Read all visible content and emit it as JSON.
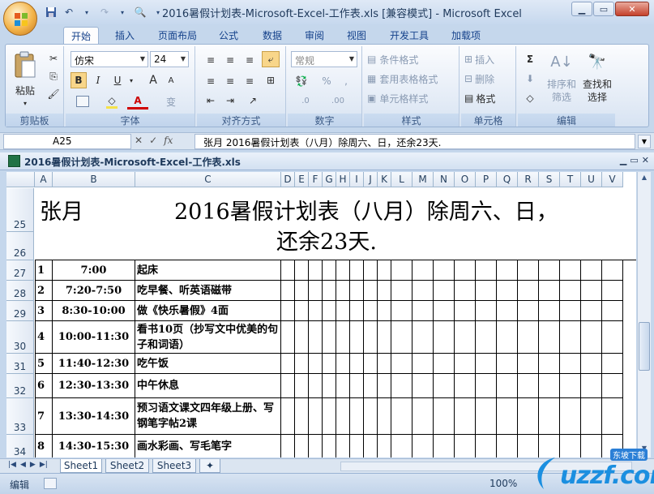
{
  "window": {
    "title": "2016暑假计划表-Microsoft-Excel-工作表.xls  [兼容模式] - Microsoft Excel"
  },
  "quick_access": {
    "save_icon": "save-icon",
    "undo_icon": "undo-icon",
    "redo_icon": "redo-icon",
    "preview_icon": "print-preview-icon"
  },
  "tabs": [
    "开始",
    "插入",
    "页面布局",
    "公式",
    "数据",
    "审阅",
    "视图",
    "开发工具",
    "加载项"
  ],
  "ribbon": {
    "clipboard": {
      "label": "剪贴板",
      "paste": "粘贴"
    },
    "font": {
      "label": "字体",
      "name": "仿宋",
      "size": "24",
      "bold": "B",
      "italic": "I",
      "underline": "U",
      "grow": "A",
      "shrink": "A",
      "font_color": "A",
      "phonetic": "变"
    },
    "alignment": {
      "label": "对齐方式"
    },
    "number": {
      "label": "数字",
      "format": "常规",
      "percent": "%",
      "comma": ",",
      "inc_decimal": ".0",
      "dec_decimal": ".00"
    },
    "styles": {
      "label": "样式",
      "conditional": "条件格式",
      "table": "套用表格格式",
      "cell_styles": "单元格样式"
    },
    "cells": {
      "label": "单元格",
      "insert": "插入",
      "delete": "删除",
      "format": "格式"
    },
    "editing": {
      "label": "编辑",
      "sum": "Σ",
      "sort": "排序和\n筛选",
      "find": "查找和\n选择"
    }
  },
  "formula_bar": {
    "name_box": "A25",
    "cancel": "✕",
    "enter": "✓",
    "fx": "fx",
    "content": "张月          2016暑假计划表（八月）除周六、日，还余23天."
  },
  "document": {
    "title": "2016暑假计划表-Microsoft-Excel-工作表.xls"
  },
  "columns": [
    "A",
    "B",
    "C",
    "D",
    "E",
    "F",
    "G",
    "H",
    "I",
    "J",
    "K",
    "L",
    "M",
    "N",
    "O",
    "P",
    "Q",
    "R",
    "S",
    "T",
    "U",
    "V"
  ],
  "sheet": {
    "title_owner": "张月",
    "title_line1": "2016暑假计划表（八月）除周六、日，",
    "title_line2": "还余23天.",
    "rows": [
      {
        "row": "27",
        "num": "1",
        "time": "7:00",
        "task": "起床"
      },
      {
        "row": "28",
        "num": "2",
        "time": "7:20-7:50",
        "task": "吃早餐、听英语磁带"
      },
      {
        "row": "29",
        "num": "3",
        "time": "8:30-10:00",
        "task": "做《快乐暑假》4面"
      },
      {
        "row": "30",
        "num": "4",
        "time": "10:00-11:30",
        "task": "看书10页（抄写文中优美的句子和词语）"
      },
      {
        "row": "31",
        "num": "5",
        "time": "11:40-12:30",
        "task": "吃午饭"
      },
      {
        "row": "32",
        "num": "6",
        "time": "12:30-13:30",
        "task": "中午休息"
      },
      {
        "row": "33",
        "num": "7",
        "time": "13:30-14:30",
        "task": "预习语文课文四年级上册、写钢笔字帖2课"
      },
      {
        "row": "34",
        "num": "8",
        "time": "14:30-15:30",
        "task": "画水彩画、写毛笔字"
      }
    ],
    "title_row_numbers": [
      "25",
      "26"
    ]
  },
  "sheet_tabs": [
    "Sheet1",
    "Sheet2",
    "Sheet3"
  ],
  "status": {
    "mode": "编辑",
    "zoom": "100%"
  },
  "watermark": {
    "text": "uzzf.com",
    "sub": "东坡下载"
  }
}
